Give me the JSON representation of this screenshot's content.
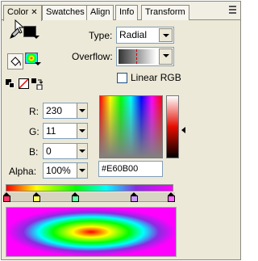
{
  "tabs": [
    {
      "label": "Color"
    },
    {
      "label": "Swatches"
    },
    {
      "label": "Align"
    },
    {
      "label": "Info"
    },
    {
      "label": "Transform"
    }
  ],
  "fill": {
    "type_label": "Type:",
    "type_value": "Radial",
    "overflow_label": "Overflow:",
    "linear_rgb_label": "Linear RGB",
    "linear_rgb_checked": false
  },
  "rgb": {
    "r_label": "R:",
    "r_value": "230",
    "g_label": "G:",
    "g_value": "11",
    "b_label": "B:",
    "b_value": "0",
    "alpha_label": "Alpha:",
    "alpha_value": "100%"
  },
  "hex_value": "#E60B00",
  "colors": {
    "selected": "#E60B00",
    "stops": [
      "#ff3366",
      "#ffff66",
      "#66ffaa",
      "#cc99ff",
      "#ff66ff"
    ]
  },
  "icons": {
    "stroke": "pencil-icon",
    "fill": "paint-bucket-icon",
    "black_white": "black-white-icon",
    "no_color": "no-color-icon",
    "swap": "swap-colors-icon",
    "close": "close-icon",
    "menu": "panel-menu-icon"
  }
}
